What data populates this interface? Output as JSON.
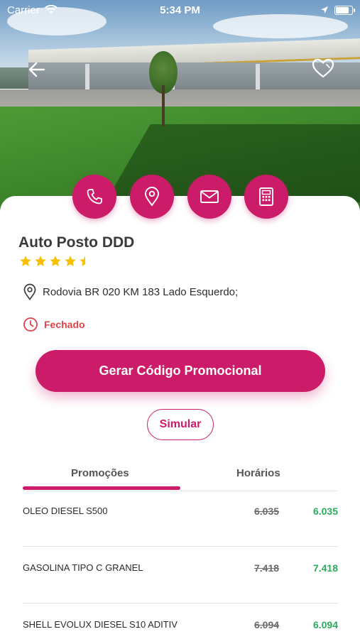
{
  "status_bar": {
    "carrier": "Carrier",
    "time": "5:34 PM",
    "battery_level": 0.85
  },
  "station": {
    "name": "Auto Posto DDD",
    "rating": 4.5,
    "rating_max": 5,
    "address": "Rodovia BR 020 KM 183 Lado Esquerdo;",
    "open_status": "Fechado"
  },
  "actions": [
    "phone-icon",
    "map-pin-icon",
    "mail-icon",
    "calculator-icon"
  ],
  "buttons": {
    "promo_label": "Gerar Código Promocional",
    "simulate_label": "Simular"
  },
  "tabs": {
    "promotions": "Promoções",
    "hours": "Horários",
    "active": "Promoções"
  },
  "products": [
    {
      "name": "OLEO DIESEL S500",
      "old_price": "6.035",
      "new_price": "6.035"
    },
    {
      "name": "GASOLINA TIPO C GRANEL",
      "old_price": "7.418",
      "new_price": "7.418"
    },
    {
      "name": "SHELL EVOLUX DIESEL S10 ADITIV",
      "old_price": "6.094",
      "new_price": "6.094"
    }
  ],
  "colors": {
    "brand": "#cc1c69",
    "price_new": "#2cad5c",
    "closed": "#e0434a",
    "star": "#f6c000"
  }
}
